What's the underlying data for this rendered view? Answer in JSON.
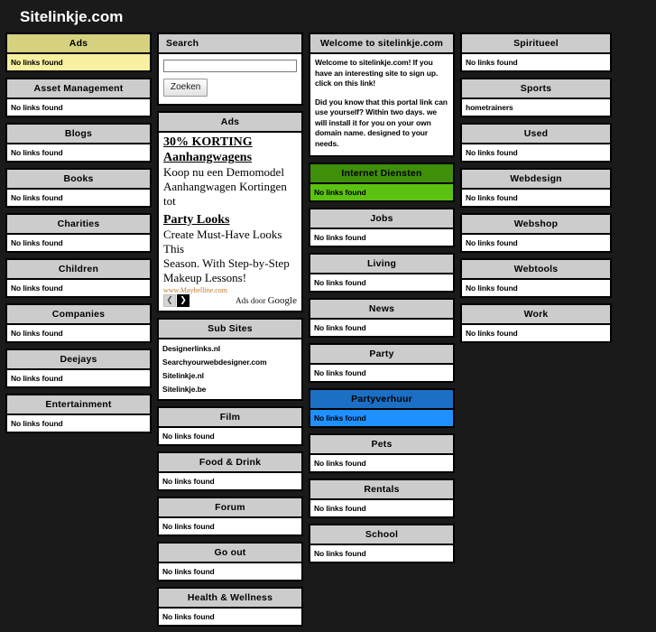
{
  "site": {
    "title": "Sitelinkje.com",
    "background_color": "#1a1a1a",
    "accent_yellow": "#f6f0a0",
    "accent_green": "#5cc211",
    "accent_blue": "#1f90ff"
  },
  "labels": {
    "no_links": "No links found"
  },
  "search": {
    "heading": "Search",
    "value": "",
    "placeholder": "",
    "button_label": "Zoeken"
  },
  "ads_panel": {
    "heading": "Ads",
    "items": [
      {
        "title_line1": "30% KORTING",
        "title_line2": "Aanhangwagens",
        "body_lines": [
          "Koop nu een Demomodel",
          "Aanhangwagen Kortingen tot"
        ],
        "url": ""
      },
      {
        "title_line1": "Party Looks",
        "title_line2": "",
        "body_lines": [
          "Create Must-Have Looks This",
          "Season. With Step-by-Step",
          "Makeup Lessons!"
        ],
        "url": "www.Maybelline.com"
      }
    ],
    "prev_label": "❮",
    "next_label": "❯",
    "ads_by": "Ads door",
    "ads_by_brand": "Google"
  },
  "welcome": {
    "heading": "Welcome to sitelinkje.com",
    "paragraphs": [
      "Welcome to sitelinkje.com! If you have an interesting site to sign up. click on this link!",
      "Did you know that this portal link can use yourself? Within two days. we will install it for you on your own domain name. designed to your needs."
    ]
  },
  "sub_sites": {
    "heading": "Sub Sites",
    "links": [
      "Designerlinks.nl",
      "Searchyourwebdesigner.com",
      "Sitelinkje.nl",
      "Sitelinkje.be"
    ]
  },
  "columns": [
    {
      "name": "column-1",
      "blocks": [
        {
          "heading": "Ads",
          "style": "yellow",
          "body": "No links found"
        },
        {
          "heading": "Asset Management",
          "style": "plain",
          "body": "No links found"
        },
        {
          "heading": "Blogs",
          "style": "plain",
          "body": "No links found"
        },
        {
          "heading": "Books",
          "style": "plain",
          "body": "No links found"
        },
        {
          "heading": "Charities",
          "style": "plain",
          "body": "No links found"
        },
        {
          "heading": "Children",
          "style": "plain",
          "body": "No links found"
        },
        {
          "heading": "Companies",
          "style": "plain",
          "body": "No links found"
        },
        {
          "heading": "Deejays",
          "style": "plain",
          "body": "No links found"
        },
        {
          "heading": "Entertainment",
          "style": "plain",
          "body": "No links found"
        }
      ]
    },
    {
      "name": "column-2",
      "blocks": [
        {
          "heading": "Film",
          "style": "plain",
          "body": "No links found"
        },
        {
          "heading": "Food & Drink",
          "style": "plain",
          "body": "No links found"
        },
        {
          "heading": "Forum",
          "style": "plain",
          "body": "No links found"
        },
        {
          "heading": "Go out",
          "style": "plain",
          "body": "No links found"
        },
        {
          "heading": "Health & Wellness",
          "style": "plain",
          "body": "No links found"
        }
      ]
    },
    {
      "name": "column-3",
      "blocks": [
        {
          "heading": "Internet Diensten",
          "style": "green",
          "body": "No links found"
        },
        {
          "heading": "Jobs",
          "style": "plain",
          "body": "No links found"
        },
        {
          "heading": "Living",
          "style": "plain",
          "body": "No links found"
        },
        {
          "heading": "News",
          "style": "plain",
          "body": "No links found"
        },
        {
          "heading": "Party",
          "style": "plain",
          "body": "No links found"
        },
        {
          "heading": "Partyverhuur",
          "style": "blue",
          "body": "No links found"
        },
        {
          "heading": "Pets",
          "style": "plain",
          "body": "No links found"
        },
        {
          "heading": "Rentals",
          "style": "plain",
          "body": "No links found"
        },
        {
          "heading": "School",
          "style": "plain",
          "body": "No links found"
        }
      ]
    },
    {
      "name": "column-4",
      "blocks": [
        {
          "heading": "Spiritueel",
          "style": "plain",
          "body": "No links found"
        },
        {
          "heading": "Sports",
          "style": "plain",
          "body": "hometrainers"
        },
        {
          "heading": "Used",
          "style": "plain",
          "body": "No links found"
        },
        {
          "heading": "Webdesign",
          "style": "plain",
          "body": "No links found"
        },
        {
          "heading": "Webshop",
          "style": "plain",
          "body": "No links found"
        },
        {
          "heading": "Webtools",
          "style": "plain",
          "body": "No links found"
        },
        {
          "heading": "Work",
          "style": "plain",
          "body": "No links found"
        }
      ]
    }
  ]
}
